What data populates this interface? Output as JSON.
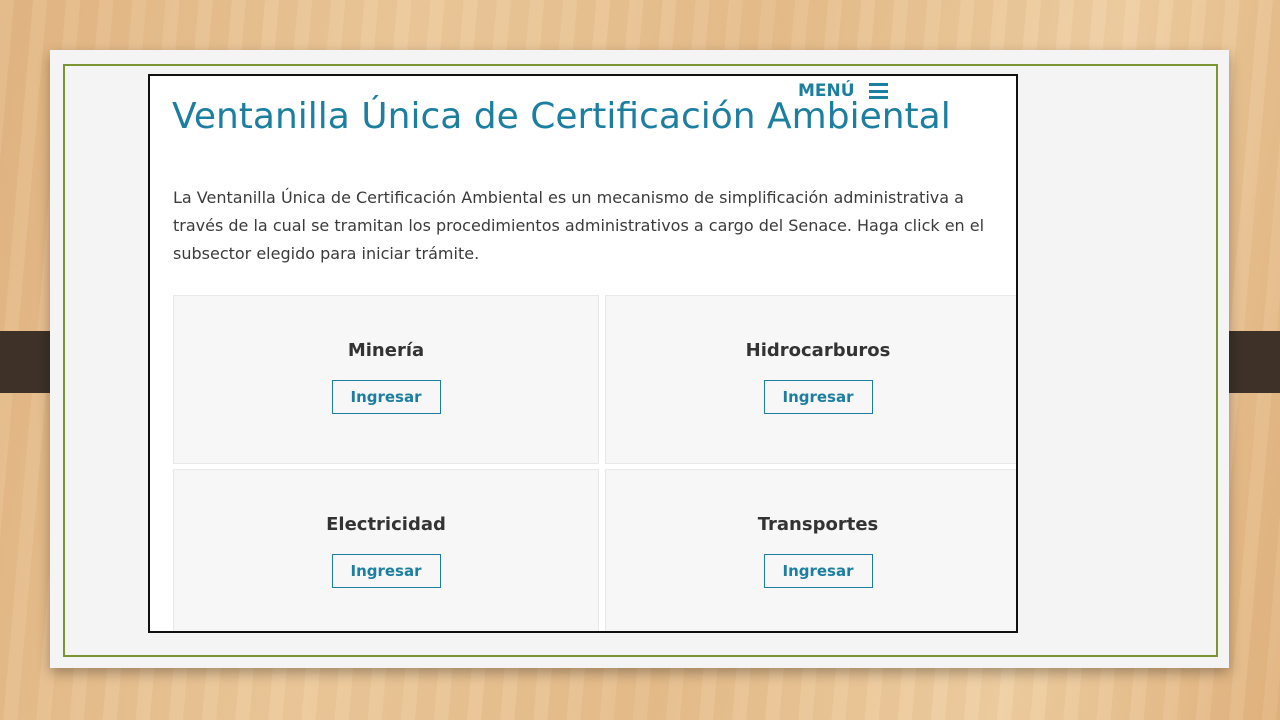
{
  "page": {
    "menu_label": "MENÚ",
    "title": "Ventanilla Única de Certificación Ambiental",
    "description": "La Ventanilla Única de Certificación Ambiental es un mecanismo de simplificación administrativa a través de la cual se tramitan los procedimientos administrativos a cargo del Senace. Haga click en el subsector elegido para iniciar trámite."
  },
  "cards": [
    {
      "title": "Minería",
      "button": "Ingresar"
    },
    {
      "title": "Hidrocarburos",
      "button": "Ingresar"
    },
    {
      "title": "Electricidad",
      "button": "Ingresar"
    },
    {
      "title": "Transportes",
      "button": "Ingresar"
    }
  ],
  "colors": {
    "accent": "#1c7fa0",
    "slide_border": "#7c9532",
    "card_background": "#f7f7f7"
  }
}
